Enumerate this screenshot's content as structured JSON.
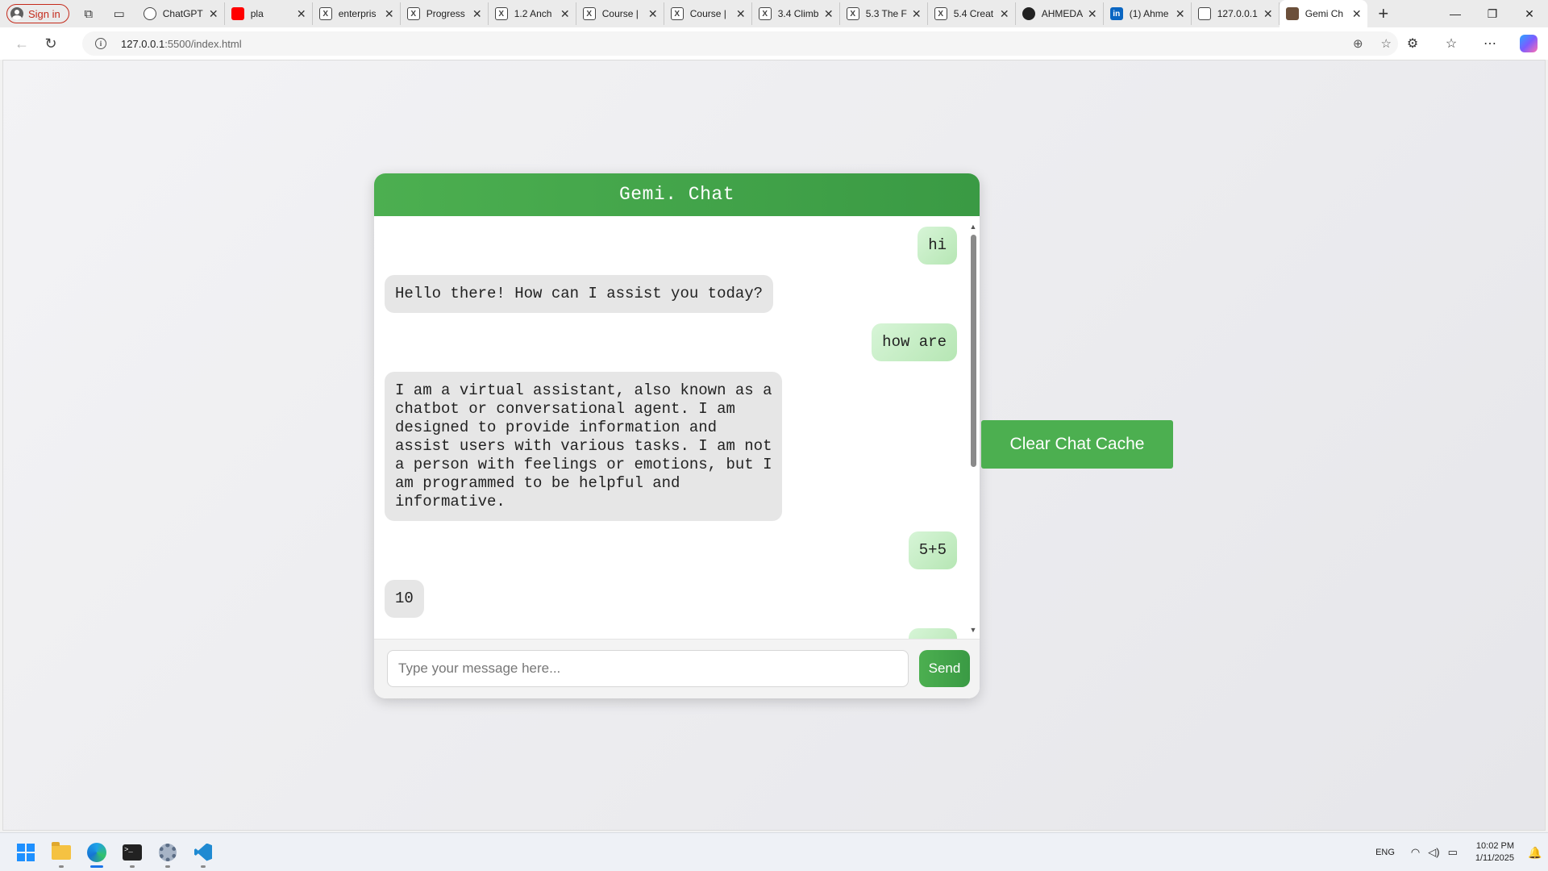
{
  "browser": {
    "signin_label": "Sign in",
    "tabs": [
      {
        "label": "ChatGPT",
        "icon": "chatgpt-icon",
        "color": "#ffffff"
      },
      {
        "label": "pla",
        "icon": "youtube-icon",
        "color": "#ff0000"
      },
      {
        "label": "enterpris",
        "icon": "x-icon",
        "color": "#ffffff"
      },
      {
        "label": "Progress",
        "icon": "x-icon",
        "color": "#ffffff"
      },
      {
        "label": "1.2 Anch",
        "icon": "x-icon",
        "color": "#ffffff"
      },
      {
        "label": "Course |",
        "icon": "x-icon",
        "color": "#ffffff"
      },
      {
        "label": "Course |",
        "icon": "x-icon",
        "color": "#ffffff"
      },
      {
        "label": "3.4 Climb",
        "icon": "x-icon",
        "color": "#ffffff"
      },
      {
        "label": "5.3 The F",
        "icon": "x-icon",
        "color": "#ffffff"
      },
      {
        "label": "5.4 Creat",
        "icon": "x-icon",
        "color": "#ffffff"
      },
      {
        "label": "AHMEDA",
        "icon": "github-icon",
        "color": "#ffffff"
      },
      {
        "label": "(1) Ahme",
        "icon": "linkedin-icon",
        "color": "#0a66c2"
      },
      {
        "label": "127.0.0.1",
        "icon": "page-icon",
        "color": "#ffffff"
      },
      {
        "label": "Gemi Ch",
        "icon": "gemi-icon",
        "color": "#6b4f3a",
        "active": true
      }
    ],
    "url_host": "127.0.0.1",
    "url_path": ":5500/index.html"
  },
  "chat": {
    "title": "Gemi. Chat",
    "messages": [
      {
        "role": "user",
        "text": "hi"
      },
      {
        "role": "bot",
        "text": "Hello there! How can I assist you today?"
      },
      {
        "role": "user",
        "text": "how are"
      },
      {
        "role": "bot",
        "text": "I am a virtual assistant, also known as a\nchatbot or conversational agent. I am\ndesigned to provide information and\nassist users with various tasks. I am not\na person with feelings or emotions, but I\nam programmed to be helpful and\ninformative."
      },
      {
        "role": "user",
        "text": "5+5"
      },
      {
        "role": "bot",
        "text": "10"
      },
      {
        "role": "user",
        "text": ""
      }
    ],
    "input_placeholder": "Type your message here...",
    "input_value": "",
    "send_label": "Send",
    "clear_label": "Clear Chat Cache",
    "accent_color": "#4caf50",
    "user_bubble_color": "#c8eec6",
    "bot_bubble_color": "#e6e6e6"
  },
  "taskbar": {
    "apps": [
      "windows-start-icon",
      "file-explorer-icon",
      "edge-browser-icon",
      "terminal-icon",
      "settings-icon",
      "vscode-icon"
    ],
    "language": "ENG",
    "time": "10:02 PM",
    "date": "1/11/2025"
  }
}
